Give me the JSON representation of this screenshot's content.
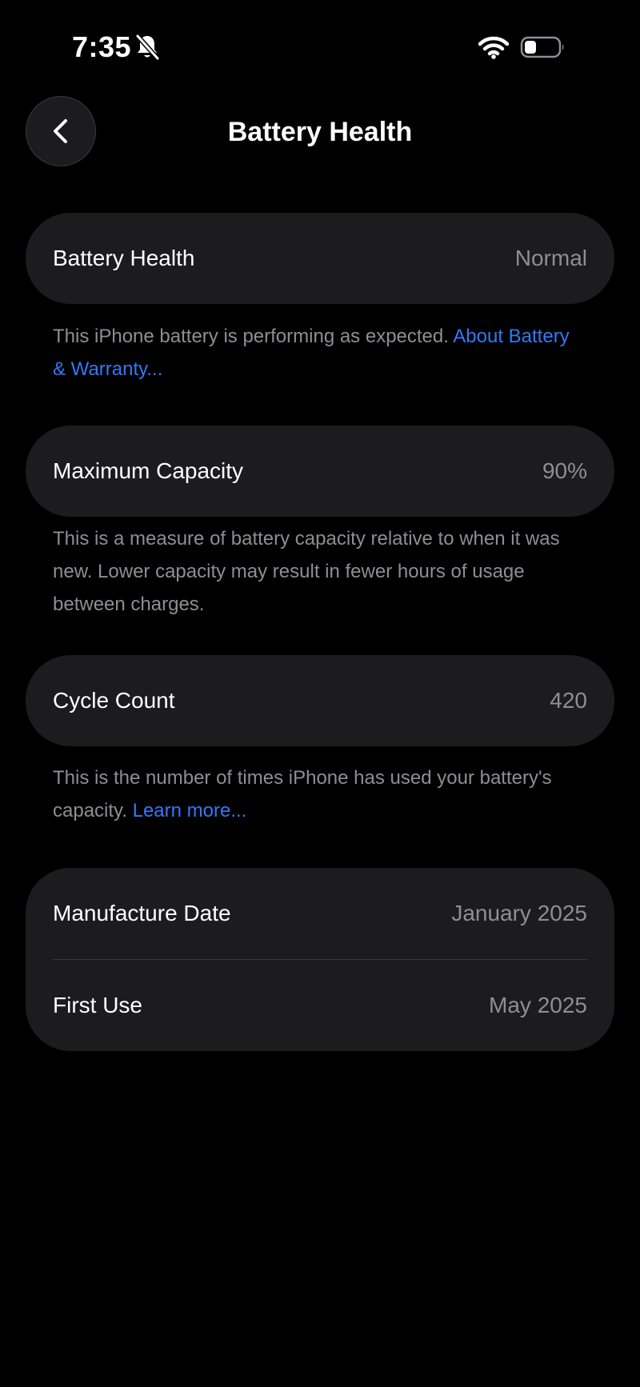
{
  "status_bar": {
    "time": "7:35",
    "icons": [
      "bell-slash-icon",
      "wifi-icon",
      "battery-icon"
    ]
  },
  "nav": {
    "back_icon": "chevron-left-icon",
    "title": "Battery Health"
  },
  "battery_health": {
    "label": "Battery Health",
    "value": "Normal",
    "note": "This iPhone battery is performing as expected. ",
    "link": "About Battery & Warranty..."
  },
  "maximum_capacity": {
    "label": "Maximum Capacity",
    "value": "90%",
    "note": "This is a measure of battery capacity relative to when it was new. Lower capacity may result in fewer hours of usage between charges."
  },
  "cycle_count": {
    "label": "Cycle Count",
    "value": "420",
    "note": "This is the number of times iPhone has used your battery's capacity. ",
    "link": "Learn more..."
  },
  "dates": {
    "manufacture_label": "Manufacture Date",
    "manufacture_value": "January 2025",
    "first_use_label": "First Use",
    "first_use_value": "May 2025"
  },
  "colors": {
    "background": "#000000",
    "card": "#1c1c1e",
    "secondary_text": "#8e8e93",
    "link": "#3478f6"
  }
}
